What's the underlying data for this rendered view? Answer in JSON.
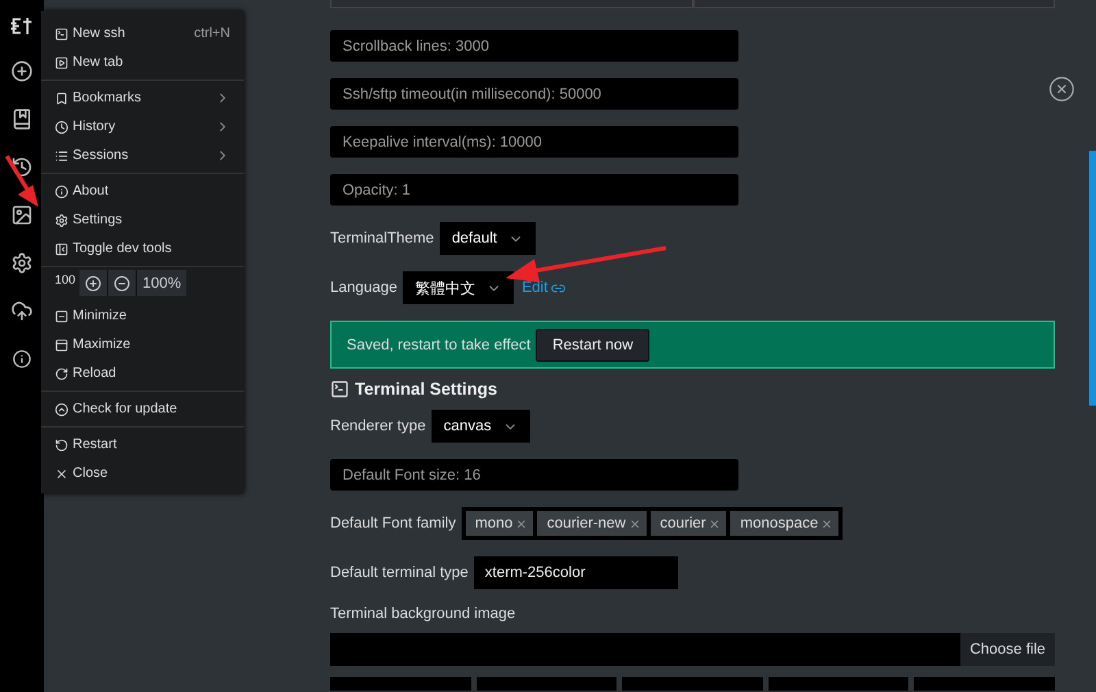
{
  "menu": {
    "groups": [
      [
        {
          "kind": "item",
          "label": "New ssh",
          "shortcut": "ctrl+N",
          "submenu": false
        },
        {
          "kind": "item",
          "label": "New tab",
          "submenu": false
        }
      ],
      [
        {
          "kind": "item",
          "label": "Bookmarks",
          "submenu": true
        },
        {
          "kind": "item",
          "label": "History",
          "submenu": true
        },
        {
          "kind": "item",
          "label": "Sessions",
          "submenu": true
        }
      ],
      [
        {
          "kind": "item",
          "label": "About",
          "submenu": false
        },
        {
          "kind": "item",
          "label": "Settings",
          "submenu": false
        },
        {
          "kind": "item",
          "label": "Toggle dev tools",
          "submenu": false
        }
      ],
      [
        {
          "kind": "zoom",
          "value": "100",
          "percent": "100%"
        },
        {
          "kind": "item",
          "label": "Minimize",
          "submenu": false
        },
        {
          "kind": "item",
          "label": "Maximize",
          "submenu": false
        },
        {
          "kind": "item",
          "label": "Reload",
          "submenu": false
        }
      ],
      [
        {
          "kind": "item",
          "label": "Check for update",
          "submenu": false
        }
      ],
      [
        {
          "kind": "item",
          "label": "Restart",
          "submenu": false
        },
        {
          "kind": "item",
          "label": "Close",
          "submenu": false
        }
      ]
    ]
  },
  "settings": {
    "inputs": [
      {
        "placeholder": "Scrollback lines: 3000"
      },
      {
        "placeholder": "Ssh/sftp timeout(in millisecond): 50000"
      },
      {
        "placeholder": "Keepalive interval(ms): 10000"
      },
      {
        "placeholder": "Opacity: 1"
      }
    ],
    "terminal_theme": {
      "label": "TerminalTheme",
      "value": "default"
    },
    "language": {
      "label": "Language",
      "value": "繁體中文",
      "link": "Edit"
    },
    "notice": {
      "text": "Saved, restart to take effect",
      "button": "Restart now"
    }
  },
  "terminal_settings": {
    "title": "Terminal Settings",
    "renderer": {
      "label": "Renderer type",
      "value": "canvas"
    },
    "font_size": {
      "placeholder": "Default Font size: 16"
    },
    "font_family": {
      "label": "Default Font family",
      "tags": [
        "mono",
        "courier-new",
        "courier",
        "monospace"
      ]
    },
    "terminal_type": {
      "label": "Default terminal type",
      "value": "xterm-256color"
    },
    "background_image": {
      "label": "Terminal background image",
      "button": "Choose file"
    }
  }
}
